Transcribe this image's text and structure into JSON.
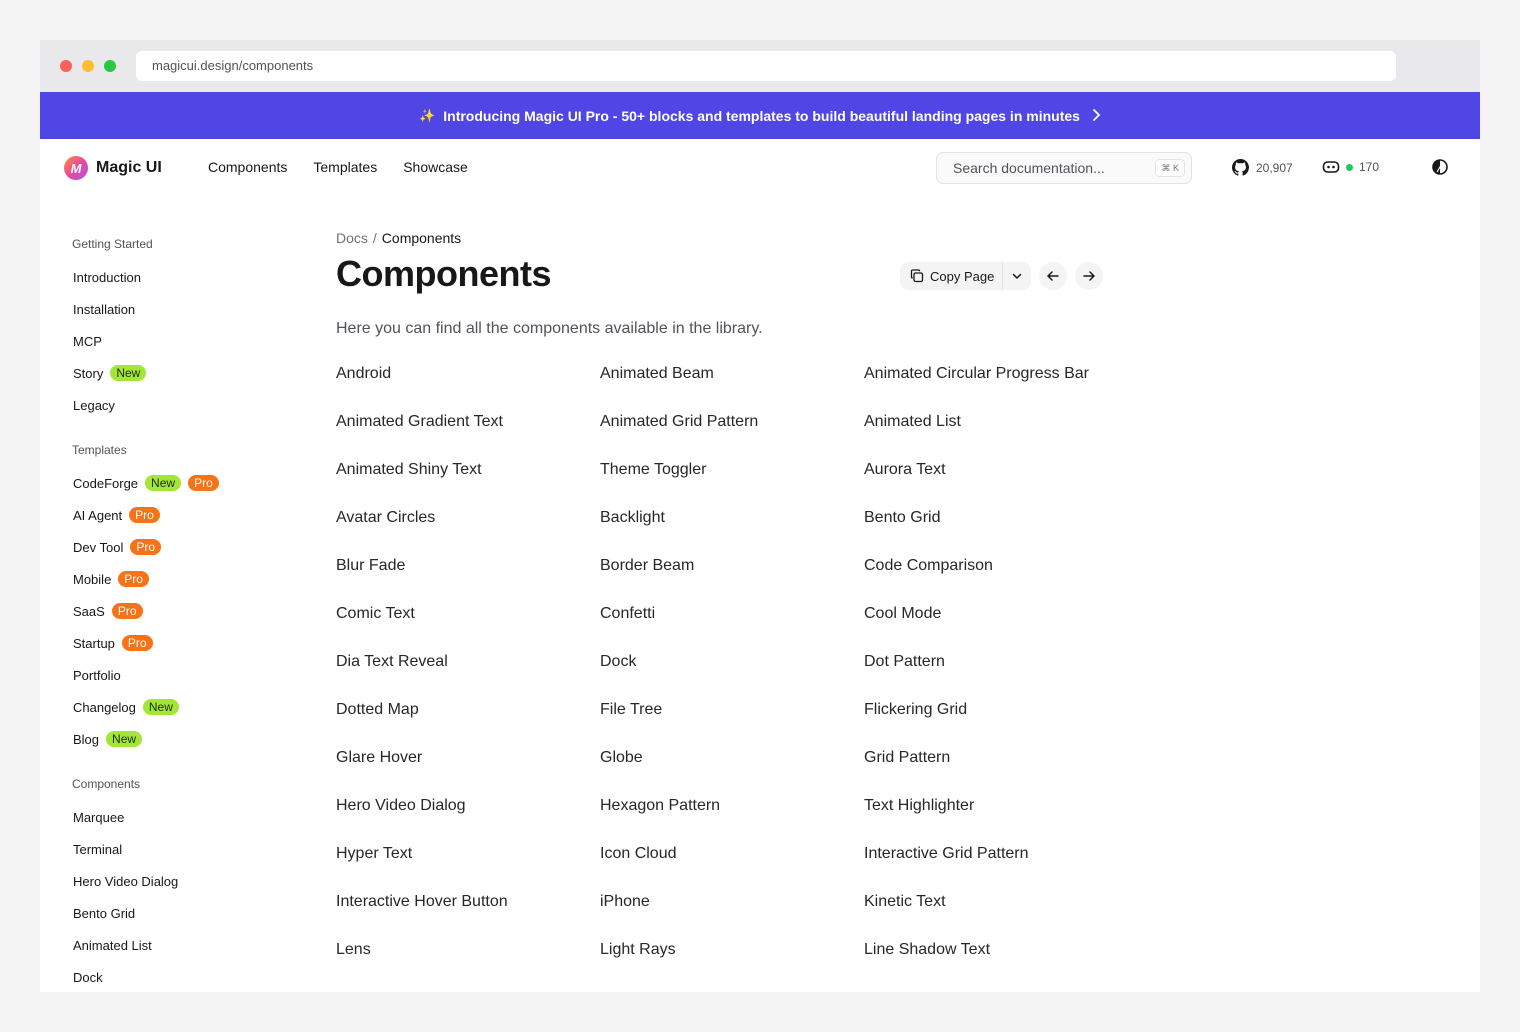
{
  "browser": {
    "url": "magicui.design/components"
  },
  "banner": {
    "text": "Introducing Magic UI Pro - 50+ blocks and templates to build beautiful landing pages in minutes"
  },
  "header": {
    "logo_mark": "M",
    "logo_text": "Magic UI",
    "nav": [
      "Components",
      "Templates",
      "Showcase"
    ],
    "search_placeholder": "Search documentation...",
    "search_shortcut": "⌘ K",
    "github_stars": "20,907",
    "discord_online": "170"
  },
  "sidebar": [
    {
      "heading": "Getting Started",
      "items": [
        {
          "label": "Introduction",
          "badges": []
        },
        {
          "label": "Installation",
          "badges": []
        },
        {
          "label": "MCP",
          "badges": []
        },
        {
          "label": "Story",
          "badges": [
            "New"
          ]
        },
        {
          "label": "Legacy",
          "badges": []
        }
      ]
    },
    {
      "heading": "Templates",
      "items": [
        {
          "label": "CodeForge",
          "badges": [
            "New",
            "Pro"
          ]
        },
        {
          "label": "AI Agent",
          "badges": [
            "Pro"
          ]
        },
        {
          "label": "Dev Tool",
          "badges": [
            "Pro"
          ]
        },
        {
          "label": "Mobile",
          "badges": [
            "Pro"
          ]
        },
        {
          "label": "SaaS",
          "badges": [
            "Pro"
          ]
        },
        {
          "label": "Startup",
          "badges": [
            "Pro"
          ]
        },
        {
          "label": "Portfolio",
          "badges": []
        },
        {
          "label": "Changelog",
          "badges": [
            "New"
          ]
        },
        {
          "label": "Blog",
          "badges": [
            "New"
          ]
        }
      ]
    },
    {
      "heading": "Components",
      "items": [
        {
          "label": "Marquee",
          "badges": []
        },
        {
          "label": "Terminal",
          "badges": []
        },
        {
          "label": "Hero Video Dialog",
          "badges": []
        },
        {
          "label": "Bento Grid",
          "badges": []
        },
        {
          "label": "Animated List",
          "badges": []
        },
        {
          "label": "Dock",
          "badges": []
        }
      ]
    }
  ],
  "main": {
    "breadcrumb_root": "Docs",
    "breadcrumb_sep": "/",
    "breadcrumb_current": "Components",
    "title": "Components",
    "copy_label": "Copy Page",
    "description": "Here you can find all the components available in the library.",
    "components": [
      "Android",
      "Animated Beam",
      "Animated Circular Progress Bar",
      "Animated Gradient Text",
      "Animated Grid Pattern",
      "Animated List",
      "Animated Shiny Text",
      "Theme Toggler",
      "Aurora Text",
      "Avatar Circles",
      "Backlight",
      "Bento Grid",
      "Blur Fade",
      "Border Beam",
      "Code Comparison",
      "Comic Text",
      "Confetti",
      "Cool Mode",
      "Dia Text Reveal",
      "Dock",
      "Dot Pattern",
      "Dotted Map",
      "File Tree",
      "Flickering Grid",
      "Glare Hover",
      "Globe",
      "Grid Pattern",
      "Hero Video Dialog",
      "Hexagon Pattern",
      "Text Highlighter",
      "Hyper Text",
      "Icon Cloud",
      "Interactive Grid Pattern",
      "Interactive Hover Button",
      "iPhone",
      "Kinetic Text",
      "Lens",
      "Light Rays",
      "Line Shadow Text"
    ]
  },
  "colors": {
    "banner": "#4f46e5",
    "badge_new": "#a3e635",
    "badge_pro": "#f97316"
  }
}
